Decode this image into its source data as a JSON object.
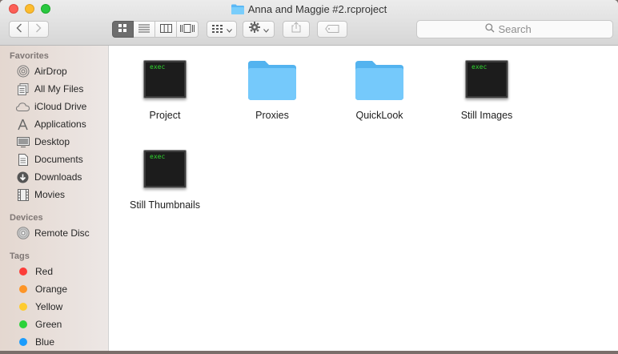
{
  "window": {
    "title": "Anna and Maggie #2.rcproject"
  },
  "toolbar": {
    "back_icon": "chevron-left-icon",
    "forward_icon": "chevron-right-icon",
    "view_modes": [
      "icon-view",
      "list-view",
      "column-view",
      "cover-flow-view"
    ],
    "active_view": "icon-view",
    "arrange_icon": "arrange-grid-icon",
    "action_icon": "gear-icon",
    "share_icon": "share-icon",
    "tag_icon": "tag-icon",
    "search": {
      "placeholder": "Search"
    }
  },
  "sidebar": {
    "favorites_header": "Favorites",
    "favorites": [
      {
        "label": "AirDrop",
        "icon": "airdrop-icon"
      },
      {
        "label": "All My Files",
        "icon": "all-files-icon"
      },
      {
        "label": "iCloud Drive",
        "icon": "cloud-icon"
      },
      {
        "label": "Applications",
        "icon": "applications-icon"
      },
      {
        "label": "Desktop",
        "icon": "desktop-icon"
      },
      {
        "label": "Documents",
        "icon": "documents-icon"
      },
      {
        "label": "Downloads",
        "icon": "downloads-icon"
      },
      {
        "label": "Movies",
        "icon": "movies-icon"
      }
    ],
    "devices_header": "Devices",
    "devices": [
      {
        "label": "Remote Disc",
        "icon": "disc-icon"
      }
    ],
    "tags_header": "Tags",
    "tags": [
      {
        "label": "Red",
        "color": "#fc3d39"
      },
      {
        "label": "Orange",
        "color": "#fd9426"
      },
      {
        "label": "Yellow",
        "color": "#fecb2f"
      },
      {
        "label": "Green",
        "color": "#2bd23a"
      },
      {
        "label": "Blue",
        "color": "#1b9cfc"
      }
    ]
  },
  "files": [
    {
      "name": "Project",
      "kind": "exec",
      "icon_text": "exec"
    },
    {
      "name": "Proxies",
      "kind": "folder"
    },
    {
      "name": "QuickLook",
      "kind": "folder"
    },
    {
      "name": "Still Images",
      "kind": "exec",
      "icon_text": "exec"
    },
    {
      "name": "Still Thumbnails",
      "kind": "exec",
      "icon_text": "exec"
    }
  ]
}
